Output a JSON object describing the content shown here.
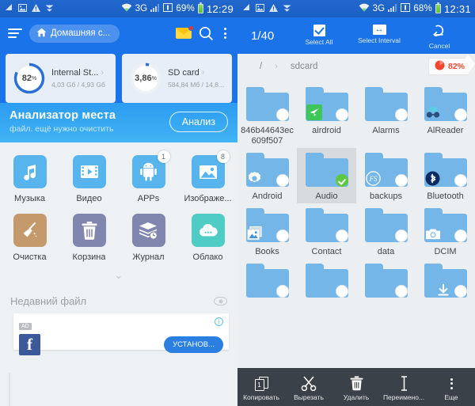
{
  "left": {
    "statusbar": {
      "icons": [
        "signal-bars-icon",
        "image-icon",
        "warning-icon",
        "download-icon"
      ],
      "wifi": "wifi-icon",
      "network": "3G",
      "signal": "signal-icon",
      "sim": "sim-icon",
      "battery_pct": "69%",
      "time": "12:29"
    },
    "toolbar": {
      "menu": "menu-icon",
      "home_label": "Домашняя с...",
      "home_icon": "home-icon",
      "mail_icon": "mail-icon",
      "search_icon": "search-icon",
      "overflow_icon": "more-vertical-icon"
    },
    "storage": [
      {
        "percent_label": "82",
        "percent_unit": "%",
        "percent_value": 82,
        "name": "Internal St...",
        "detail": "4,03 Gб / 4,93 Gб",
        "arc_color": "#2a6fd4"
      },
      {
        "percent_label": "3,86",
        "percent_unit": "%",
        "percent_value": 3.86,
        "name": "SD card",
        "detail": "584,84 Mб / 14,8...",
        "arc_color": "#2a6fd4"
      }
    ],
    "analyzer": {
      "title": "Анализатор места",
      "subtitle": "файл. ещё нужно очистить",
      "button": "Анализ"
    },
    "apps": [
      {
        "label": "Музыка",
        "icon": "music-note-icon",
        "color": "#58b4ec",
        "badge": ""
      },
      {
        "label": "Видео",
        "icon": "video-film-icon",
        "color": "#58b4ec",
        "badge": ""
      },
      {
        "label": "APPs",
        "icon": "android-icon",
        "color": "#58b4ec",
        "badge": "1"
      },
      {
        "label": "Изображе...",
        "icon": "picture-icon",
        "color": "#58b4ec",
        "badge": "8"
      },
      {
        "label": "Очистка",
        "icon": "broom-icon",
        "color": "#c49a6c",
        "badge": ""
      },
      {
        "label": "Корзина",
        "icon": "trash-icon",
        "color": "#8186ae",
        "badge": ""
      },
      {
        "label": "Журнал",
        "icon": "log-layers-icon",
        "color": "#8186ae",
        "badge": ""
      },
      {
        "label": "Облако",
        "icon": "cloud-icon",
        "color": "#4fcdc4",
        "badge": ""
      }
    ],
    "expand_icon": "chevron-down-icon",
    "recent": {
      "title": "Недавний файл",
      "eye_icon": "eye-icon"
    },
    "ad": {
      "tag": "AD",
      "info_icon": "info-icon",
      "brand_icon": "facebook-icon",
      "brand_letter": "f",
      "button": "УСТАНОВ..."
    }
  },
  "right": {
    "statusbar": {
      "network": "3G",
      "battery_pct": "68%",
      "time": "12:31"
    },
    "selectionbar": {
      "count": "1/40",
      "actions": [
        {
          "label": "Select All",
          "icon": "checkbox-icon"
        },
        {
          "label": "Select Interval",
          "icon": "interval-arrows-icon"
        },
        {
          "label": "Cancel",
          "icon": "undo-arrow-icon"
        }
      ]
    },
    "breadcrumb": {
      "root": "/",
      "separator": "›",
      "current": "sdcard",
      "usage_badge": "82%",
      "usage_icon": "pie-chart-icon"
    },
    "files": [
      {
        "name": "846b44643ec609f507",
        "overlay": "",
        "selected": false
      },
      {
        "name": "airdroid",
        "overlay": "airdroid-icon",
        "selected": false
      },
      {
        "name": "Alarms",
        "overlay": "",
        "selected": false
      },
      {
        "name": "AlReader",
        "overlay": "glasses-icon",
        "selected": false
      },
      {
        "name": "Android",
        "overlay": "gear-icon",
        "selected": false
      },
      {
        "name": "Audio",
        "overlay": "",
        "selected": true
      },
      {
        "name": "backups",
        "overlay": "es-icon",
        "selected": false
      },
      {
        "name": "Bluetooth",
        "overlay": "bluetooth-icon",
        "selected": false
      },
      {
        "name": "Books",
        "overlay": "image-icon",
        "selected": false
      },
      {
        "name": "Contact",
        "overlay": "",
        "selected": false
      },
      {
        "name": "data",
        "overlay": "",
        "selected": false
      },
      {
        "name": "DCIM",
        "overlay": "camera-icon",
        "selected": false
      },
      {
        "name": "",
        "overlay": "",
        "selected": false
      },
      {
        "name": "",
        "overlay": "",
        "selected": false
      },
      {
        "name": "",
        "overlay": "",
        "selected": false
      },
      {
        "name": "",
        "overlay": "download-icon",
        "selected": false
      }
    ],
    "bottombar": [
      {
        "label": "Копировать",
        "icon": "copy-icon",
        "badge": "1"
      },
      {
        "label": "Вырезать",
        "icon": "scissors-icon",
        "badge": ""
      },
      {
        "label": "Удалить",
        "icon": "trash-icon",
        "badge": ""
      },
      {
        "label": "Переимено...",
        "icon": "rename-icon",
        "badge": ""
      },
      {
        "label": "Еще",
        "icon": "more-vertical-icon",
        "badge": ""
      }
    ]
  }
}
